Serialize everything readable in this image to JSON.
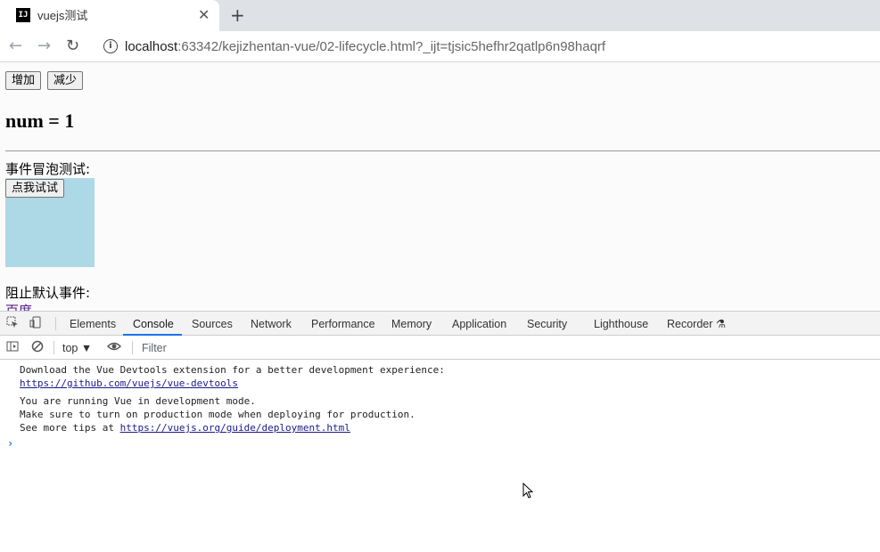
{
  "browser": {
    "tab": {
      "favicon": "IJ",
      "title": "vuejs测试",
      "close": "✕"
    },
    "new_tab": "+",
    "nav": {
      "back": "←",
      "forward": "→",
      "reload": "↻"
    },
    "address": {
      "info_icon": "i",
      "host": "localhost",
      "rest": ":63342/kejizhentan-vue/02-lifecycle.html?_ijt=tjsic5hefhr2qatlp6n98haqrf"
    }
  },
  "page": {
    "buttons": {
      "increase": "增加",
      "decrease": "减少"
    },
    "num_text": "num = 1",
    "bubble_label": "事件冒泡测试:",
    "bubble_button": "点我试试",
    "prevent_label": "阻止默认事件:",
    "link_text": "百度"
  },
  "devtools": {
    "tabs": [
      "Elements",
      "Console",
      "Sources",
      "Network",
      "Performance",
      "Memory",
      "Application",
      "Security",
      "Lighthouse",
      "Recorder ⚗"
    ],
    "active_tab": "Console",
    "context": "top ▼",
    "filter_placeholder": "Filter",
    "console": {
      "msg1_line1": "Download the Vue Devtools extension for a better development experience:",
      "msg1_link": "https://github.com/vuejs/vue-devtools",
      "msg2_line1": "You are running Vue in development mode.",
      "msg2_line2": "Make sure to turn on production mode when deploying for production.",
      "msg2_line3_prefix": "See more tips at ",
      "msg2_link": "https://vuejs.org/guide/deployment.html",
      "prompt": "›"
    }
  },
  "colors": {
    "accent": "#1a73e8",
    "box": "#add8e6",
    "link_visited": "#551a8b"
  }
}
